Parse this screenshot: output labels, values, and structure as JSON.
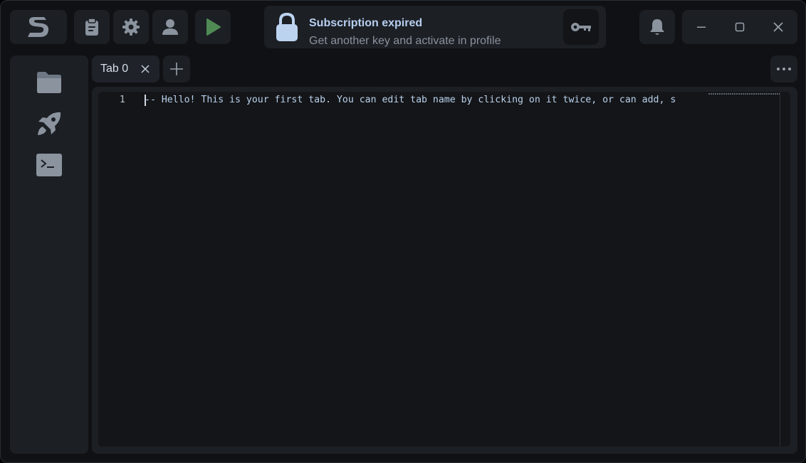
{
  "toolbar": {
    "logo": "logo-icon",
    "buttons": [
      {
        "name": "clipboard-button",
        "icon": "clipboard-icon"
      },
      {
        "name": "settings-button",
        "icon": "gear-icon"
      },
      {
        "name": "profile-button",
        "icon": "user-icon"
      },
      {
        "name": "run-button",
        "icon": "play-icon"
      }
    ]
  },
  "banner": {
    "title": "Subscription expired",
    "subtitle": "Get another key and activate in profile",
    "lock_icon": "lock-icon",
    "key_icon": "key-icon"
  },
  "notifications": {
    "icon": "bell-icon"
  },
  "window_controls": [
    "minimize-icon",
    "maximize-icon",
    "close-icon"
  ],
  "sidebar": {
    "items": [
      {
        "name": "files",
        "icon": "folder-icon"
      },
      {
        "name": "launch",
        "icon": "rocket-icon"
      },
      {
        "name": "console",
        "icon": "terminal-icon"
      }
    ]
  },
  "tabs": [
    {
      "label": "Tab 0",
      "active": true
    }
  ],
  "editor": {
    "line_numbers": [
      "1"
    ],
    "lines": [
      "-- Hello! This is your first tab. You can edit tab name by clicking on it twice, or can add, s"
    ]
  },
  "colors": {
    "background": "#101114",
    "panel": "#1c1f24",
    "accent": "#b7cff0",
    "play": "#4f8a55",
    "icon": "#8a939e"
  }
}
